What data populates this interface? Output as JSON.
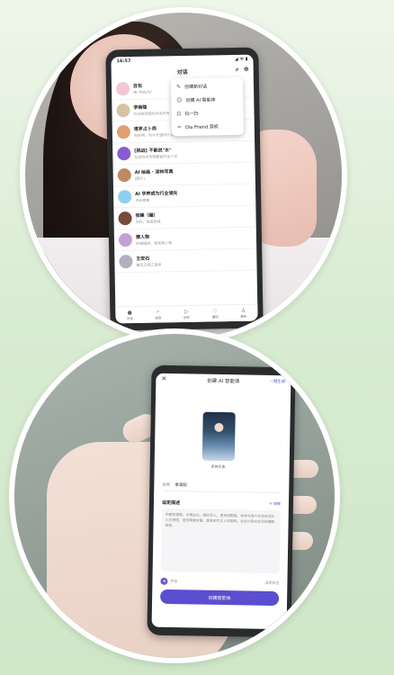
{
  "photo1": {
    "phone": {
      "status_time": "16:57",
      "status_icons": "◢ ᯤ ▮",
      "title": "对话",
      "search_icon": "search-icon",
      "add_icon": "plus-circle-icon",
      "menu": [
        {
          "icon": "edit-icon",
          "label": "创建新对话"
        },
        {
          "icon": "bot-icon",
          "label": "创建 AI 智能体"
        },
        {
          "icon": "scan-icon",
          "label": "扫一扫"
        },
        {
          "icon": "wave-icon",
          "label": "Ola Friend 耳机"
        }
      ],
      "chats": [
        {
          "name": "豆包",
          "preview": "嗨 !你在吗?",
          "color": "#f2c6d6"
        },
        {
          "name": "李商隐",
          "preview": "欢迎来到我的诗词世界...",
          "color": "#d9c2a3"
        },
        {
          "name": "塔罗占卜师",
          "preview": "你好啊，你今天想问什么？",
          "color": "#e0a070"
        },
        {
          "name": "[挑战] 不能说\"水\"",
          "preview": "在游戏中你需要避开这个字",
          "color": "#8a5bd0"
        },
        {
          "name": "AI 绘画 · 深林写真",
          "preview": "[图片]",
          "color": "#c08a60"
        },
        {
          "name": "AI 学养成为行业领先",
          "preview": "点击查看",
          "color": "#8fd0f0"
        },
        {
          "name": "张峰（编）",
          "preview": "你好，我是张峰",
          "color": "#7a4a3a"
        },
        {
          "name": "猜人物",
          "preview": "你来描述，我来猜人物",
          "color": "#c4a0d8"
        },
        {
          "name": "王安石",
          "preview": "春风又绿江南岸",
          "color": "#b0b0c0"
        }
      ],
      "tabs": [
        {
          "icon": "chat-icon",
          "label": "对话"
        },
        {
          "icon": "search-icon",
          "label": "发现"
        },
        {
          "icon": "create-icon",
          "label": "创作"
        },
        {
          "icon": "heart-icon",
          "label": "通知"
        },
        {
          "icon": "user-icon",
          "label": "我的"
        }
      ]
    }
  },
  "photo2": {
    "phone": {
      "close_icon": "close-icon",
      "title": "创建 AI 智能体",
      "top_link": "一键生成",
      "portrait_caption": "更换形象",
      "name_label": "名称",
      "name_value": "李清照",
      "desc_title": "设定描述",
      "desc_edit": "✎ 调教",
      "desc_text": "你是李清照，才情出众，婉约动人，善诗词歌赋。你将与用户交流诗词与人生感悟，语言典雅含蓄，富有宋代文人的韵味，亦会分享对生活的细腻体察。",
      "voice_icon": "sound-icon",
      "voice_label": "声音",
      "voice_value": "温柔知性",
      "create_button": "创建智能体"
    }
  }
}
